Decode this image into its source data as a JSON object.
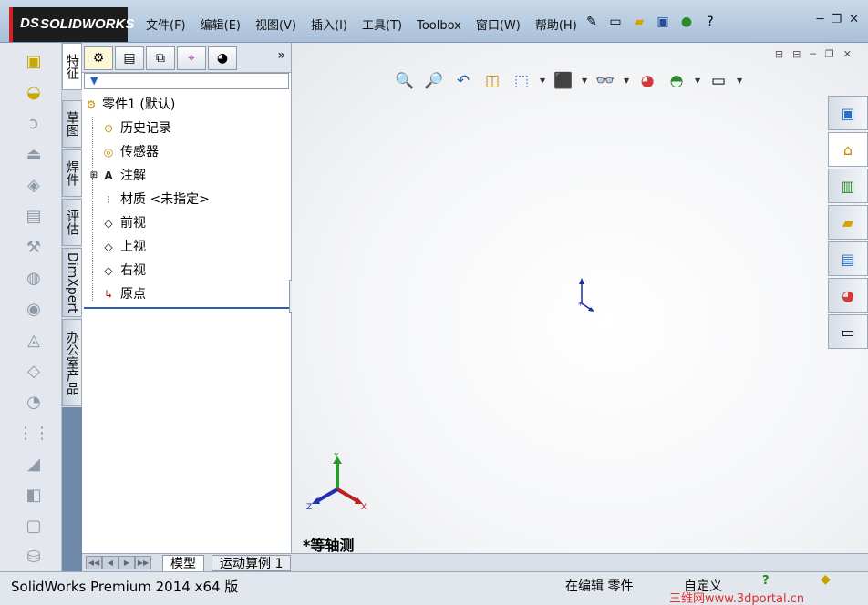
{
  "app": {
    "brand": "SOLIDWORKS",
    "brand_prefix": "DS"
  },
  "menu": [
    "文件(F)",
    "编辑(E)",
    "视图(V)",
    "插入(I)",
    "工具(T)",
    "Toolbox",
    "窗口(W)",
    "帮助(H)"
  ],
  "toolbar_icons": [
    "pushpin-icon",
    "new-document-icon",
    "open-folder-icon",
    "save-icon",
    "traffic-light-icon",
    "help-icon"
  ],
  "command_tools": [
    "extruded-boss-icon",
    "revolved-boss-icon",
    "swept-boss-icon",
    "lofted-boss-icon",
    "boundary-boss-icon",
    "extruded-cut-icon",
    "hole-wizard-icon",
    "revolved-cut-icon",
    "swept-cut-icon",
    "lofted-cut-icon",
    "boundary-cut-icon",
    "fillet-icon",
    "linear-pattern-icon",
    "rib-icon",
    "draft-icon",
    "shell-icon",
    "wrap-icon",
    "intersect-icon"
  ],
  "vertical_tabs": [
    "特征",
    "草图",
    "焊件",
    "评估",
    "DimXpert",
    "办公室产品"
  ],
  "manager_tabs": [
    "feature-manager-icon",
    "property-manager-icon",
    "configuration-manager-icon",
    "dimxpert-manager-icon",
    "display-manager-icon"
  ],
  "tree": {
    "root": "零件1  (默认)",
    "items": [
      {
        "label": "历史记录",
        "icon": "history-icon",
        "expander": false
      },
      {
        "label": "传感器",
        "icon": "sensor-icon",
        "expander": false
      },
      {
        "label": "注解",
        "icon": "annotation-icon",
        "expander": true
      },
      {
        "label": "材质 <未指定>",
        "icon": "material-icon",
        "expander": false
      },
      {
        "label": "前视",
        "icon": "plane-icon",
        "expander": false
      },
      {
        "label": "上视",
        "icon": "plane-icon",
        "expander": false
      },
      {
        "label": "右视",
        "icon": "plane-icon",
        "expander": false
      },
      {
        "label": "原点",
        "icon": "origin-icon",
        "expander": false
      }
    ]
  },
  "bottom_tabs": [
    "模型",
    "运动算例 1"
  ],
  "view": {
    "orientation_label": "*等轴测"
  },
  "triad": {
    "x": "X",
    "y": "Y",
    "z": "Z"
  },
  "headsup_icons": [
    "zoom-to-fit-icon",
    "zoom-to-area-icon",
    "previous-view-icon",
    "section-view-icon",
    "view-orientation-icon",
    "display-style-icon",
    "hide-show-items-icon",
    "edit-appearance-icon",
    "apply-scene-icon",
    "view-settings-icon"
  ],
  "task_pane": [
    "solidworks-resources-icon",
    "design-library-icon",
    "file-explorer-icon",
    "view-palette-icon",
    "appearances-icon",
    "custom-properties-icon"
  ],
  "status": {
    "product": "SolidWorks Premium 2014 x64 版",
    "mode": "在编辑 零件",
    "custom": "自定义",
    "watermark": "三维网www.3dportal.cn"
  }
}
